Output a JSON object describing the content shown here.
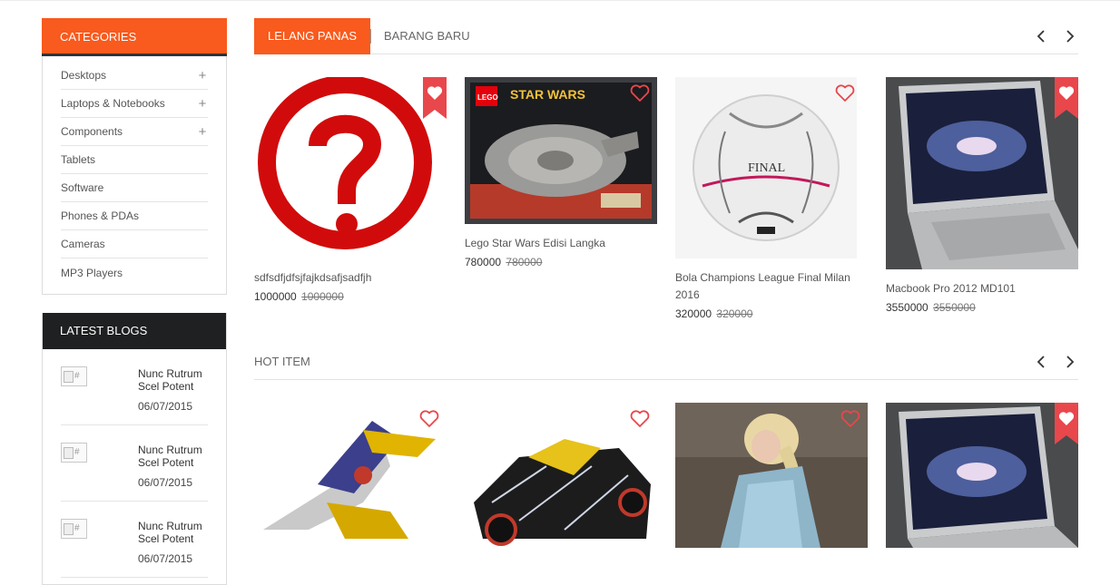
{
  "sidebar": {
    "categories_title": "CATEGORIES",
    "categories": [
      {
        "label": "Desktops",
        "expand": "+"
      },
      {
        "label": "Laptops & Notebooks",
        "expand": "+"
      },
      {
        "label": "Components",
        "expand": "+"
      },
      {
        "label": "Tablets",
        "expand": ""
      },
      {
        "label": "Software",
        "expand": ""
      },
      {
        "label": "Phones & PDAs",
        "expand": ""
      },
      {
        "label": "Cameras",
        "expand": ""
      },
      {
        "label": "MP3 Players",
        "expand": ""
      }
    ],
    "blogs_title": "LATEST BLOGS",
    "blogs": [
      {
        "img_alt": "#",
        "title": "Nunc Rutrum Scel Potent",
        "date": "06/07/2015"
      },
      {
        "img_alt": "#",
        "title": "Nunc Rutrum Scel Potent",
        "date": "06/07/2015"
      },
      {
        "img_alt": "#",
        "title": "Nunc Rutrum Scel Potent",
        "date": "06/07/2015"
      }
    ]
  },
  "auction": {
    "tab_active": "LELANG PANAS",
    "tab_other": "BARANG BARU",
    "products": [
      {
        "name": "sdfsdfjdfsjfajkdsafjsadfjh",
        "price": "1000000",
        "old_price": "1000000",
        "wishlist": "ribbon"
      },
      {
        "name": "Lego Star Wars Edisi Langka",
        "price": "780000",
        "old_price": "780000",
        "wishlist": "outline"
      },
      {
        "name": "Bola Champions League Final Milan 2016",
        "price": "320000",
        "old_price": "320000",
        "wishlist": "outline"
      },
      {
        "name": "Macbook Pro 2012 MD101",
        "price": "3550000",
        "old_price": "3550000",
        "wishlist": "ribbon"
      }
    ]
  },
  "hot": {
    "title": "HOT ITEM",
    "products": [
      {
        "wishlist": "outline"
      },
      {
        "wishlist": "outline"
      },
      {
        "wishlist": "outline"
      },
      {
        "wishlist": "ribbon"
      }
    ]
  },
  "images": {
    "lego_box_brand": "LEGO",
    "lego_box_title": "STAR WARS",
    "ball_text": "FINAL"
  },
  "colors": {
    "accent": "#f95a1d",
    "dark": "#1f2022",
    "heart": "#e8474c"
  }
}
